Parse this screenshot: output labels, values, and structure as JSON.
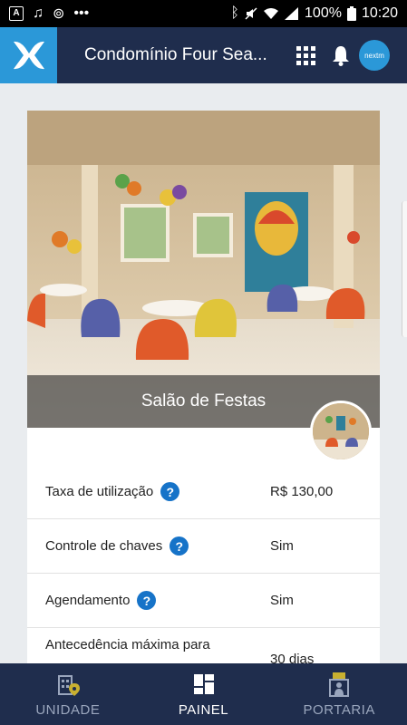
{
  "status_bar": {
    "battery": "100%",
    "time": "10:20",
    "icons": [
      "a-icon",
      "music-icon",
      "sync-icon",
      "more-dots-icon",
      "bluetooth-icon",
      "mute-icon",
      "wifi-icon",
      "signal-icon",
      "battery-icon"
    ]
  },
  "header": {
    "title": "Condomínio Four Sea...",
    "avatar_text": "nextm"
  },
  "card": {
    "hero_label": "Salão de Festas",
    "rows": [
      {
        "label": "Taxa de utilização",
        "value": "R$ 130,00"
      },
      {
        "label": "Controle de chaves",
        "value": "Sim"
      },
      {
        "label": "Agendamento",
        "value": "Sim"
      },
      {
        "label": "Antecedência máxima para",
        "value": "30 dias"
      }
    ]
  },
  "bottom_nav": {
    "items": [
      {
        "label": "UNIDADE"
      },
      {
        "label": "PAINEL"
      },
      {
        "label": "PORTARIA"
      }
    ]
  },
  "colors": {
    "header_bg": "#1f2d4d",
    "brand_blue": "#2b98d8",
    "help_blue": "#1673c8"
  }
}
